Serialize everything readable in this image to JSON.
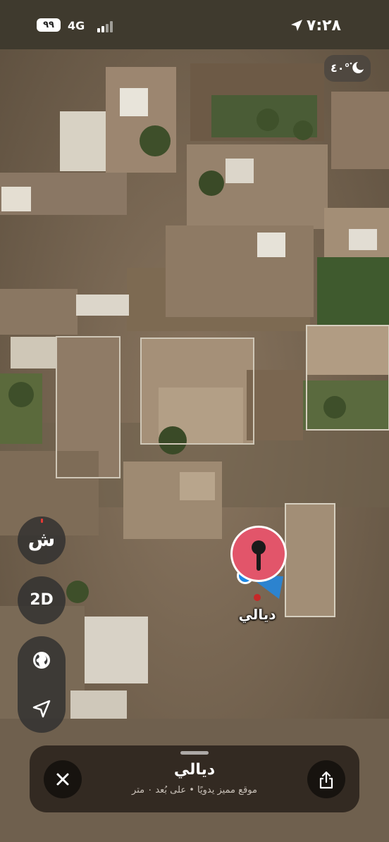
{
  "status_bar": {
    "time": "٧:٢٨",
    "network": "4G",
    "battery": "٩٩",
    "signal_icon": "signal-bars-icon",
    "location_icon": "location-arrow-icon"
  },
  "weather": {
    "temperature": "٤٠°",
    "icon": "moon-cloud-icon"
  },
  "controls": {
    "compass_label": "ش",
    "view_mode_label": "2D",
    "globe_icon": "globe-icon",
    "locate_icon": "locate-arrow-icon"
  },
  "pin": {
    "label": "ديالي",
    "color": "#e2556a"
  },
  "sheet": {
    "title": "ديالي",
    "subtitle": "موقع مميز يدويًا • على بُعد ٠ متر",
    "close_icon": "close-icon",
    "share_icon": "share-icon"
  },
  "colors": {
    "accent_blue": "#1e88e5",
    "pin_red": "#e2556a"
  }
}
